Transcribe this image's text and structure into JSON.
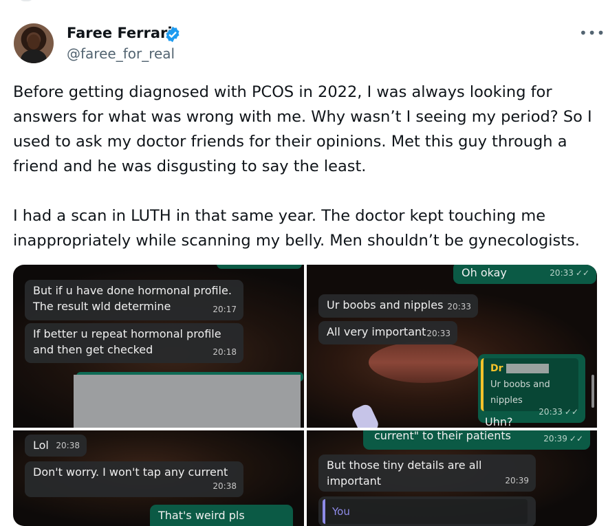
{
  "user": {
    "display_name": "Faree Ferrari",
    "handle": "@faree_for_real"
  },
  "tweet": {
    "paragraph1": "Before getting diagnosed with PCOS in 2022, I was always looking for answers for what was wrong with me. Why wasn’t I seeing my period? So I used to ask my doctor friends for their opinions. Met this guy through a friend and he was disgusting to say the least.",
    "paragraph2": "I had a scan in LUTH in that same year. The doctor kept touching me inappropriately while scanning my belly. Men shouldn’t be gynecologists."
  },
  "more_label": "•••",
  "colors": {
    "verified": "#1d9bf0",
    "text": "#0f1419",
    "secondary": "#536471",
    "bubble_in": "#2a2c2e",
    "bubble_out": "#0b5a45",
    "quote_accent": "#f5c32b"
  },
  "images": {
    "img1": {
      "b1_text": "But if u have done hormonal profile. The result wld determine",
      "b1_time": "20:17",
      "b2_text": "If better u repeat hormonal profile and then get checked",
      "b2_time": "20:18"
    },
    "img2": {
      "b1_text": "Oh okay",
      "b1_time": "20:33",
      "b2_text": "Ur boobs and nipples",
      "b2_time": "20:33",
      "b3_text": "All very important",
      "b3_time": "20:33",
      "quote_name": "Dr",
      "quote_text": "Ur boobs and nipples",
      "b4_text": "Uhn?",
      "b4_time": "20:33"
    },
    "img3": {
      "b1_text": "Lol",
      "b1_time": "20:38",
      "b2_text": "Don't worry. I won't tap any current",
      "b2_time": "20:38",
      "b3_text": "That's weird pls"
    },
    "img4": {
      "b1_text": "current\" to their patients",
      "b1_time": "20:39",
      "b2_text": "But those tiny details are all important",
      "b2_time": "20:39",
      "b3_text": "You"
    }
  }
}
